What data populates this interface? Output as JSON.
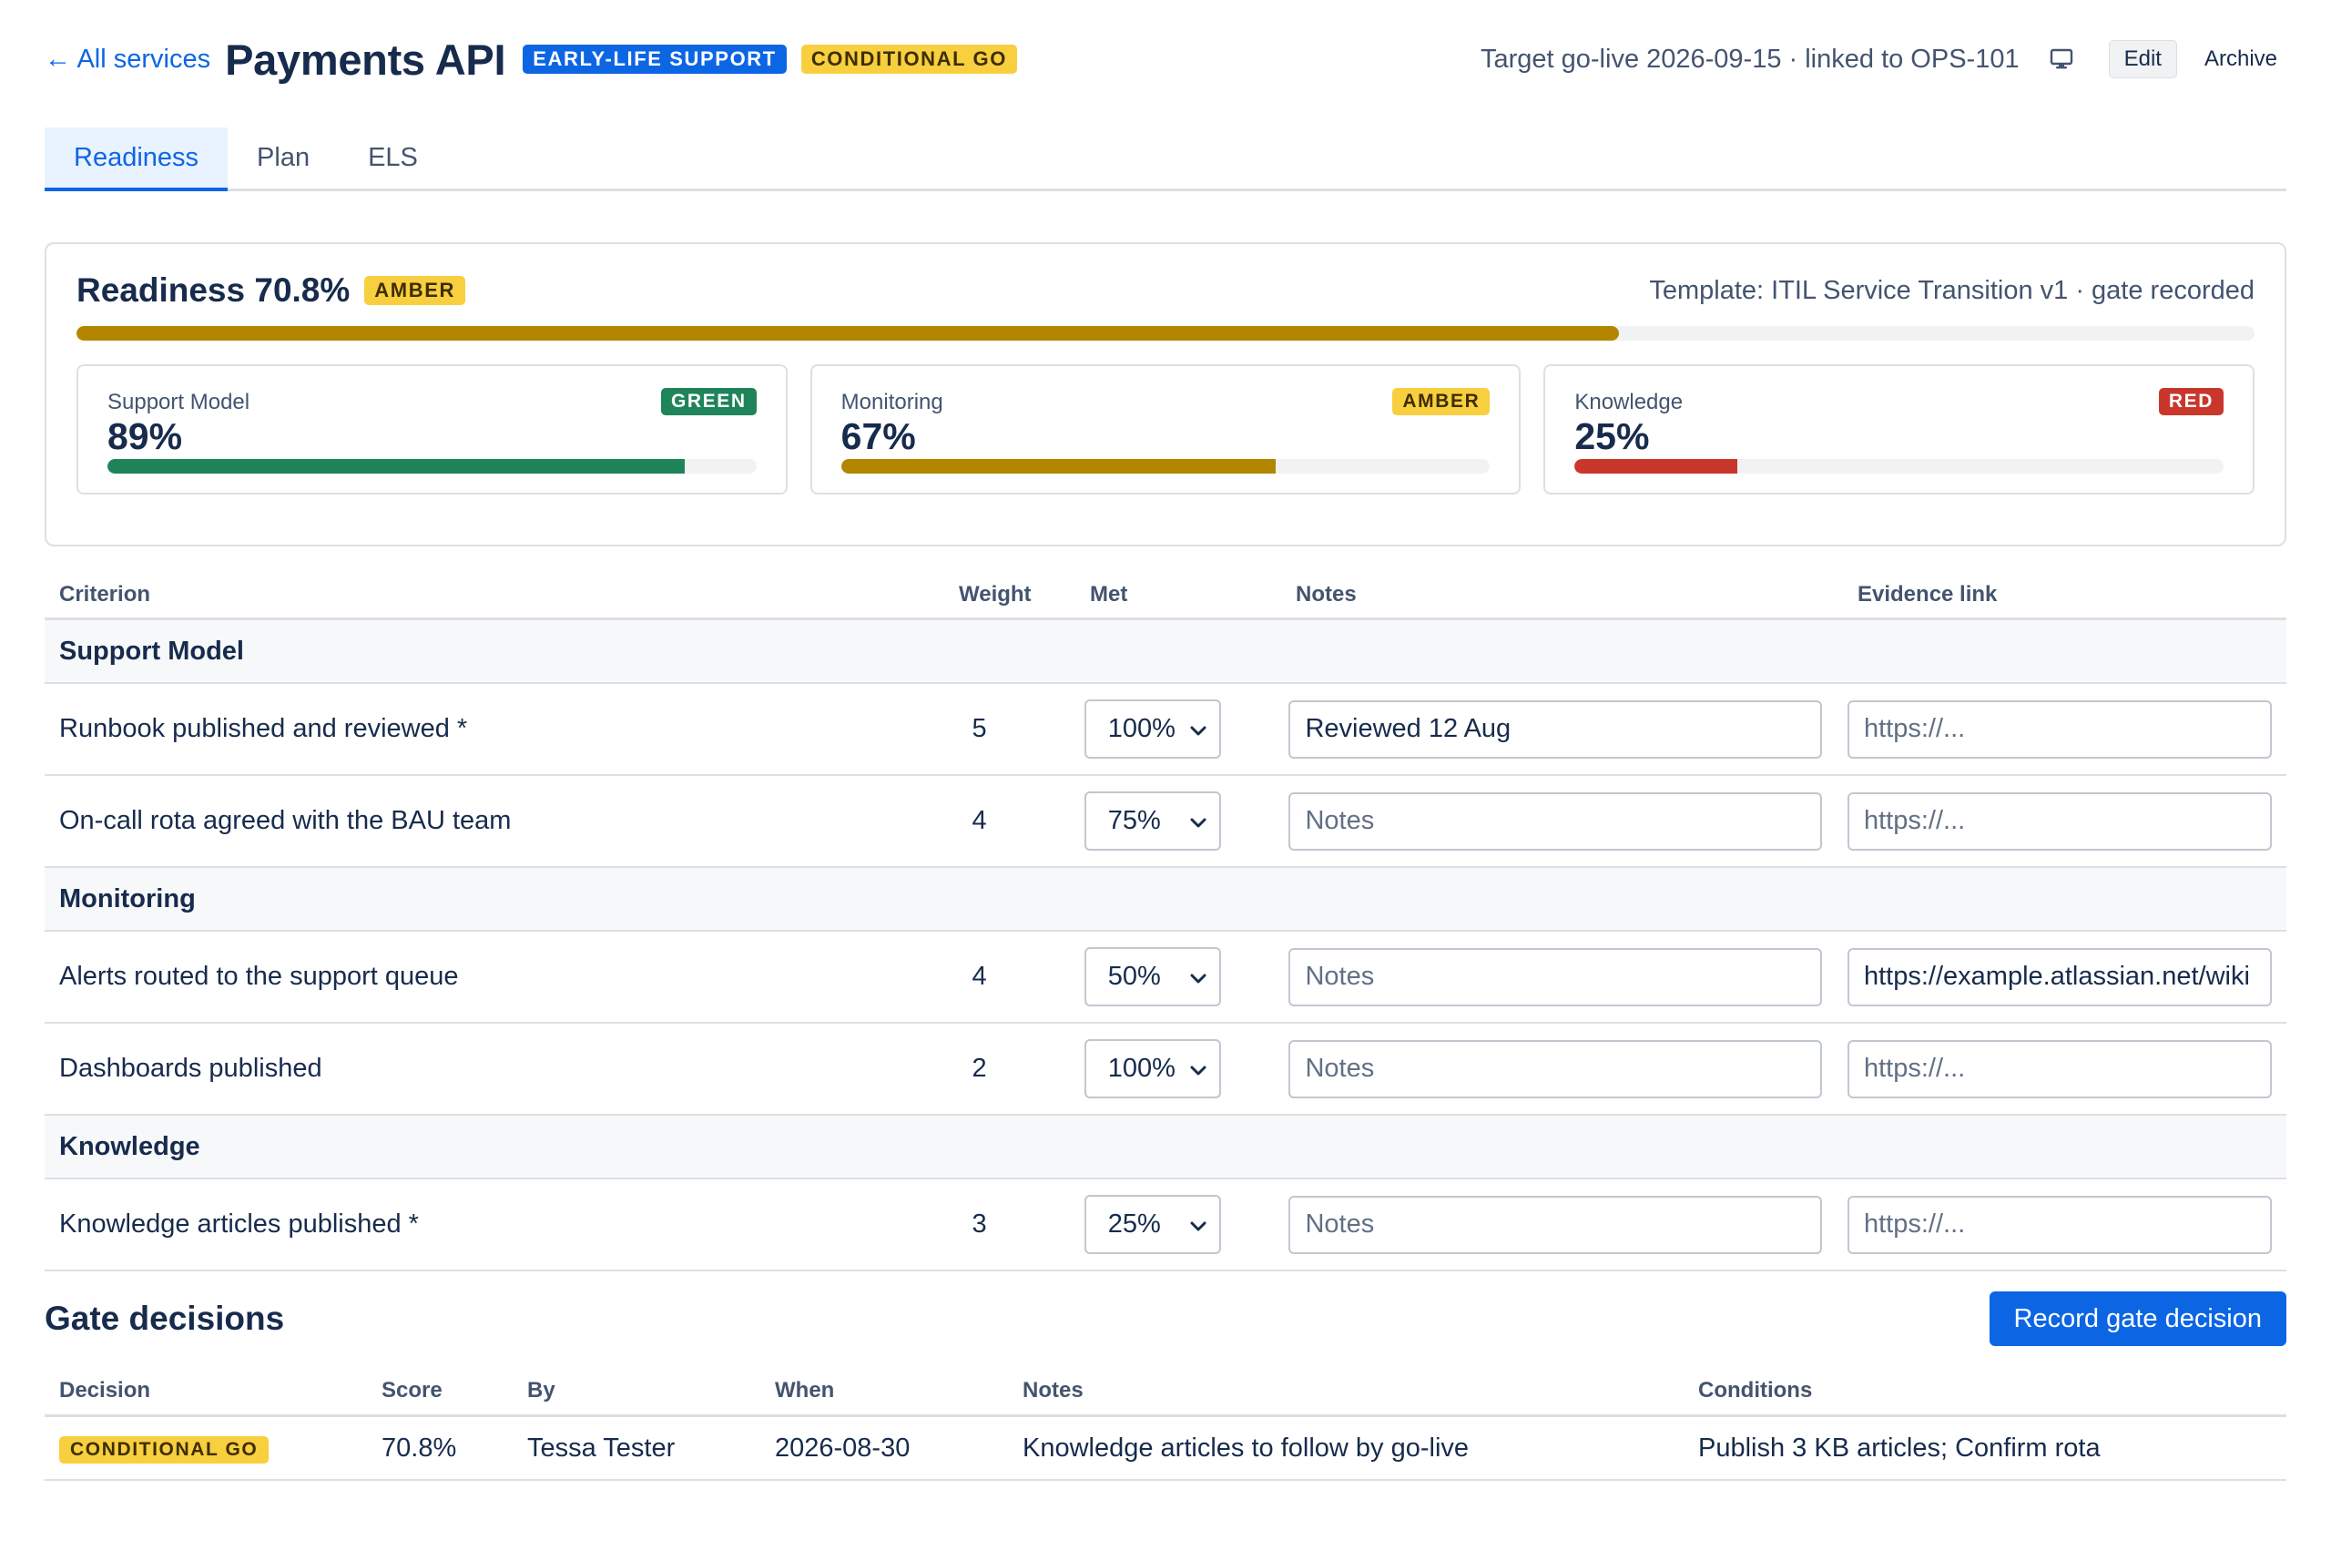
{
  "header": {
    "back_label": "← All services",
    "title": "Payments API",
    "badges": [
      "EARLY-LIFE SUPPORT",
      "CONDITIONAL GO"
    ],
    "target_text": "Target go-live 2026-09-15 · linked to OPS-101",
    "edit_label": "Edit",
    "archive_label": "Archive"
  },
  "tabs": [
    {
      "label": "Readiness",
      "active": true
    },
    {
      "label": "Plan",
      "active": false
    },
    {
      "label": "ELS",
      "active": false
    }
  ],
  "summary": {
    "title": "Readiness 70.8%",
    "status": "AMBER",
    "template_text": "Template: ITIL Service Transition v1 · gate recorded",
    "progress": 0.708,
    "progress_color": "#b38600",
    "cards": [
      {
        "name": "Support Model",
        "status": "GREEN",
        "pct": "89%",
        "fill": 0.89,
        "color": "#1f845a"
      },
      {
        "name": "Monitoring",
        "status": "AMBER",
        "pct": "67%",
        "fill": 0.67,
        "color": "#b38600"
      },
      {
        "name": "Knowledge",
        "status": "RED",
        "pct": "25%",
        "fill": 0.25,
        "color": "#c9372c"
      }
    ]
  },
  "criteria": {
    "headers": {
      "criterion": "Criterion",
      "weight": "Weight",
      "met": "Met",
      "notes": "Notes",
      "evidence": "Evidence link"
    },
    "groups": [
      {
        "name": "Support Model",
        "rows": [
          {
            "criterion": "Runbook published and reviewed *",
            "weight": "5",
            "met": "100%",
            "notes": "Reviewed 12 Aug",
            "notes_placeholder": "Notes",
            "evidence": "",
            "evidence_placeholder": "https://..."
          },
          {
            "criterion": "On-call rota agreed with the BAU team",
            "weight": "4",
            "met": "75%",
            "notes": "",
            "notes_placeholder": "Notes",
            "evidence": "",
            "evidence_placeholder": "https://..."
          }
        ]
      },
      {
        "name": "Monitoring",
        "rows": [
          {
            "criterion": "Alerts routed to the support queue",
            "weight": "4",
            "met": "50%",
            "notes": "",
            "notes_placeholder": "Notes",
            "evidence": "https://example.atlassian.net/wiki",
            "evidence_placeholder": "https://..."
          },
          {
            "criterion": "Dashboards published",
            "weight": "2",
            "met": "100%",
            "notes": "",
            "notes_placeholder": "Notes",
            "evidence": "",
            "evidence_placeholder": "https://..."
          }
        ]
      },
      {
        "name": "Knowledge",
        "rows": [
          {
            "criterion": "Knowledge articles published *",
            "weight": "3",
            "met": "25%",
            "notes": "",
            "notes_placeholder": "Notes",
            "evidence": "",
            "evidence_placeholder": "https://..."
          }
        ]
      }
    ]
  },
  "gate": {
    "title": "Gate decisions",
    "record_label": "Record gate decision",
    "headers": {
      "decision": "Decision",
      "score": "Score",
      "by": "By",
      "when": "When",
      "notes": "Notes",
      "conditions": "Conditions"
    },
    "rows": [
      {
        "decision": "CONDITIONAL GO",
        "score": "70.8%",
        "by": "Tessa Tester",
        "when": "2026-08-30",
        "notes": "Knowledge articles to follow by go-live",
        "conditions": "Publish 3 KB articles; Confirm rota"
      }
    ]
  },
  "icons": {
    "monitor": "monitor-icon",
    "chevron": "chevron-down-icon"
  },
  "colors": {
    "accent": "#0c66e4",
    "green": "#1f845a",
    "amber": "#b38600",
    "red": "#c9372c",
    "yellow_badge": "#f8cf3f"
  }
}
